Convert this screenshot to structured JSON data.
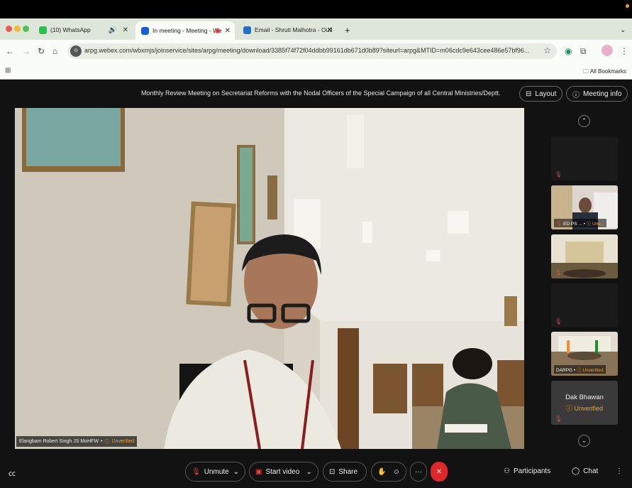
{
  "browser": {
    "tabs": [
      {
        "label": "(10) WhatsApp"
      },
      {
        "label": "In meeting - Meeting - We"
      },
      {
        "label": "Email - Shruti Malhotra - Outl"
      }
    ],
    "new_tab": "+",
    "url": "arpg.webex.com/wbxmjs/joinservice/sites/arpg/meeting/download/3385f74f72f04ddbb99161db671d0b89?siteurl=arpg&MTID=m06cdc9e643cee486e57bf96...",
    "bookmarks_label": "All Bookmarks"
  },
  "meeting": {
    "title": "Monthly Review Meeting on Secretariat Reforms with the Nodal Officers of the Special Campaign of all Central Ministries/Deptt.",
    "layout_label": "Layout",
    "info_label": "Meeting info",
    "speaker_name": "Elangbam Robert Singh JS MoHFW",
    "unverified": "Unverified"
  },
  "participants": [
    {
      "label": "",
      "state": "muted-blank"
    },
    {
      "label": "ED PS ...",
      "unverified": "Unv..."
    },
    {
      "label": "",
      "state": "room"
    },
    {
      "label": "",
      "state": "muted-blank"
    },
    {
      "label": "DARPG",
      "unverified": "Unverified"
    },
    {
      "label": "Dak Bhawan",
      "unverified": "Unverified"
    }
  ],
  "controls": {
    "unmute": "Unmute",
    "start_video": "Start video",
    "share": "Share",
    "more": "···",
    "participants": "Participants",
    "chat": "Chat",
    "more_right": "⋮"
  },
  "colors": {
    "end_call": "#e0282c",
    "unverified": "#e8a33c",
    "muted": "#e0483c"
  }
}
